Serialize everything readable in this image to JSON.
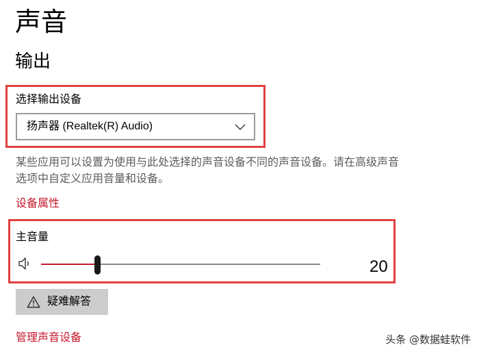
{
  "page": {
    "title": "声音"
  },
  "output": {
    "section_title": "输出",
    "device_label": "选择输出设备",
    "device_selected": "扬声器 (Realtek(R) Audio)",
    "description": "某些应用可以设置为使用与此处选择的声音设备不同的声音设备。请在高级声音选项中自定义应用音量和设备。",
    "device_properties_link": "设备属性",
    "master_volume_label": "主音量",
    "master_volume_value": "20",
    "volume_fraction": 0.2,
    "troubleshoot_label": "疑难解答",
    "manage_devices_link": "管理声音设备"
  },
  "watermark": "头条 @数据蛙软件",
  "icons": {
    "speaker": "speaker-icon",
    "warning": "warning-icon",
    "chevron": "chevron-down-icon"
  },
  "colors": {
    "accent": "#c5172b",
    "highlight_border": "#e04040",
    "button_bg": "#cccccc"
  }
}
